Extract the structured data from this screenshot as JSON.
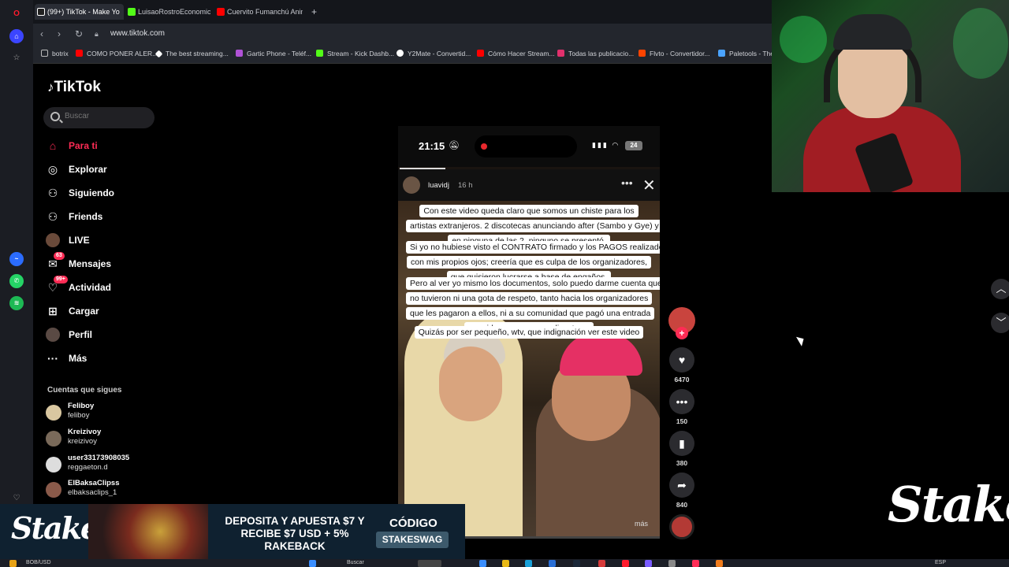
{
  "browser": {
    "tabs": [
      {
        "label": "(99+) TikTok - Make Yo",
        "color": "#ffffff",
        "active": true
      },
      {
        "label": "LuisaoRostroEconomico S",
        "color": "#53fc18",
        "active": false
      },
      {
        "label": "Cuervito Fumanchú Anim",
        "color": "#ff0000",
        "active": false
      }
    ],
    "new_tab": "+",
    "url": "www.tiktok.com",
    "bookmarks": [
      {
        "label": "botrix",
        "color": "#888888"
      },
      {
        "label": "COMO PONER ALER...",
        "color": "#ff0000"
      },
      {
        "label": "The best streaming...",
        "color": "#ffffff"
      },
      {
        "label": "Gartic Phone - Teléf...",
        "color": "#b052d6"
      },
      {
        "label": "Stream - Kick Dashb...",
        "color": "#53fc18"
      },
      {
        "label": "Y2Mate - Convertid...",
        "color": "#ffffff"
      },
      {
        "label": "Cómo Hacer Stream...",
        "color": "#ff0000"
      },
      {
        "label": "Todas las publicacio...",
        "color": "#e1306c"
      },
      {
        "label": "Flvto - Convertidor...",
        "color": "#ff4400"
      },
      {
        "label": "Paletools - The",
        "color": "#4aa3ff"
      }
    ]
  },
  "tiktok": {
    "logo": "TikTok",
    "search_placeholder": "Buscar",
    "nav": [
      {
        "label": "Para ti",
        "icon": "home-icon",
        "glyph": "⌂",
        "active": true,
        "badge": ""
      },
      {
        "label": "Explorar",
        "icon": "compass-icon",
        "glyph": "◎",
        "active": false,
        "badge": ""
      },
      {
        "label": "Siguiendo",
        "icon": "following-icon",
        "glyph": "⚇",
        "active": false,
        "badge": ""
      },
      {
        "label": "Friends",
        "icon": "friends-icon",
        "glyph": "⚇",
        "active": false,
        "badge": ""
      },
      {
        "label": "LIVE",
        "icon": "live-icon",
        "glyph": "●",
        "active": false,
        "badge": ""
      },
      {
        "label": "Mensajes",
        "icon": "messages-icon",
        "glyph": "✉",
        "active": false,
        "badge": "63"
      },
      {
        "label": "Actividad",
        "icon": "activity-icon",
        "glyph": "♡",
        "active": false,
        "badge": "99+"
      },
      {
        "label": "Cargar",
        "icon": "upload-icon",
        "glyph": "⊞",
        "active": false,
        "badge": ""
      },
      {
        "label": "Perfil",
        "icon": "profile-icon",
        "glyph": "●",
        "active": false,
        "badge": ""
      },
      {
        "label": "Más",
        "icon": "more-icon",
        "glyph": "···",
        "active": false,
        "badge": ""
      }
    ],
    "following_title": "Cuentas que sigues",
    "accounts": [
      {
        "name": "Feliboy",
        "handle": "feliboy",
        "color": "#d9c7a0"
      },
      {
        "name": "Kreizivoy",
        "handle": "kreizivoy",
        "color": "#7a6a5a"
      },
      {
        "name": "user33173908035",
        "handle": "reggaeton.d",
        "color": "#dddddd"
      },
      {
        "name": "ElBaksaClipss",
        "handle": "elbaksaclips_1",
        "color": "#8a5a4a"
      }
    ]
  },
  "video": {
    "phone_time": "21:15",
    "battery": "24",
    "story_user": "luavidj",
    "story_time": "16 h",
    "caption_lines": [
      "Con este video queda claro que somos un chiste para los",
      "artistas extranjeros. 2 discotecas anunciando after (Sambo y Gye) y",
      "en ninguna de las 2, ninguno se presentó.",
      "Si yo no hubiese visto el CONTRATO firmado y los PAGOS realizados",
      "con mis propios ojos; creería que es culpa de los organizadores,",
      "que quisieron lucrarse a base de engaños.",
      "Pero al ver yo mismo los documentos, solo puedo darme cuenta que",
      "no tuvieron ni una gota de respeto, tanto hacia los organizadores",
      "que les pagaron a ellos, ni a su comunidad que pagó una entrada",
      "para irlos a ver en una discoteca.",
      "Quizás por ser pequeño, wtv, que indignación ver este video"
    ],
    "more_label": "más",
    "progress": 0.06
  },
  "actions": {
    "likes": "6470",
    "comments": "150",
    "saves": "380",
    "shares": "840"
  },
  "ad": {
    "brand": "Stake",
    "headline": "DEPOSITA Y APUESTA $7 Y RECIBE $7 USD + 5% RAKEBACK",
    "code_label": "CÓDIGO",
    "code": "STAKESWAG"
  },
  "taskbar": {
    "ticker": "BOB/USD",
    "search": "Buscar",
    "lang": "ESP"
  }
}
